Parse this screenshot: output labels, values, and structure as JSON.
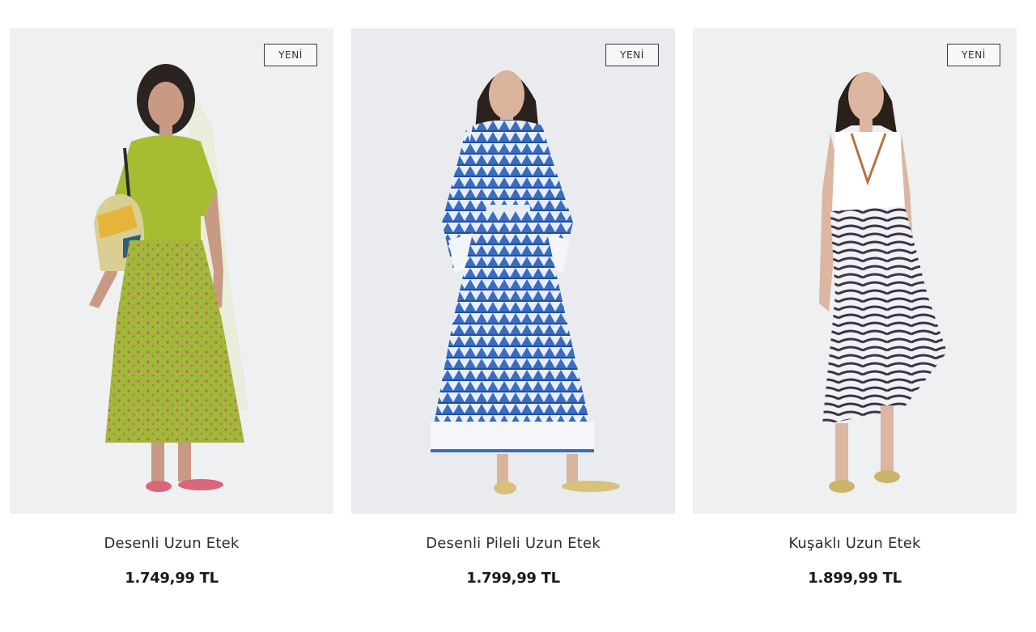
{
  "products": [
    {
      "badge": "YENİ",
      "name": "Desenli Uzun Etek",
      "price": "1.749,99 TL",
      "colors": {
        "primary": "#9fb535",
        "accent": "#c85a6a",
        "shoes": "#d9667a"
      }
    },
    {
      "badge": "YENİ",
      "name": "Desenli Pileli Uzun Etek",
      "price": "1.799,99 TL",
      "colors": {
        "primary": "#3f6fc4",
        "accent": "#ffffff",
        "shoes": "#d8c27a"
      }
    },
    {
      "badge": "YENİ",
      "name": "Kuşaklı Uzun Etek",
      "price": "1.899,99 TL",
      "colors": {
        "primary": "#3b3446",
        "accent": "#ffffff",
        "shoes": "#cdb36a"
      }
    }
  ]
}
